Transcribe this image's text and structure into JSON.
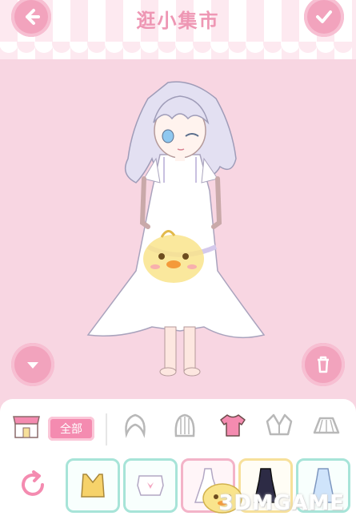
{
  "header": {
    "title": "逛小集市",
    "back_icon": "arrow-left-icon",
    "confirm_icon": "checkmark-icon"
  },
  "stage": {
    "character": "girl-in-white-dress",
    "mascot": "yellow-chick-mascot",
    "down_icon": "chevron-down-icon",
    "trash_icon": "trash-icon"
  },
  "categories": {
    "shop_icon": "shop-icon",
    "all_label": "全部",
    "items": [
      {
        "icon": "hair-icon"
      },
      {
        "icon": "wig-icon"
      },
      {
        "icon": "tshirt-icon",
        "active": true
      },
      {
        "icon": "jacket-icon"
      },
      {
        "icon": "skirt-icon"
      }
    ]
  },
  "items": {
    "refresh_icon": "refresh-icon",
    "list": [
      {
        "name": "yellow-crop-top"
      },
      {
        "name": "white-ribbon-top"
      },
      {
        "name": "white-gown",
        "selected": true
      },
      {
        "name": "black-dress",
        "gold": true
      },
      {
        "name": "blue-slip-dress"
      }
    ]
  },
  "watermark": "3DMGAME",
  "colors": {
    "background": "#f8d6e2",
    "button": "#f2a3bd",
    "title": "#ee97b4",
    "accent": "#f48bb0",
    "item_border": "#a7e4d8"
  }
}
